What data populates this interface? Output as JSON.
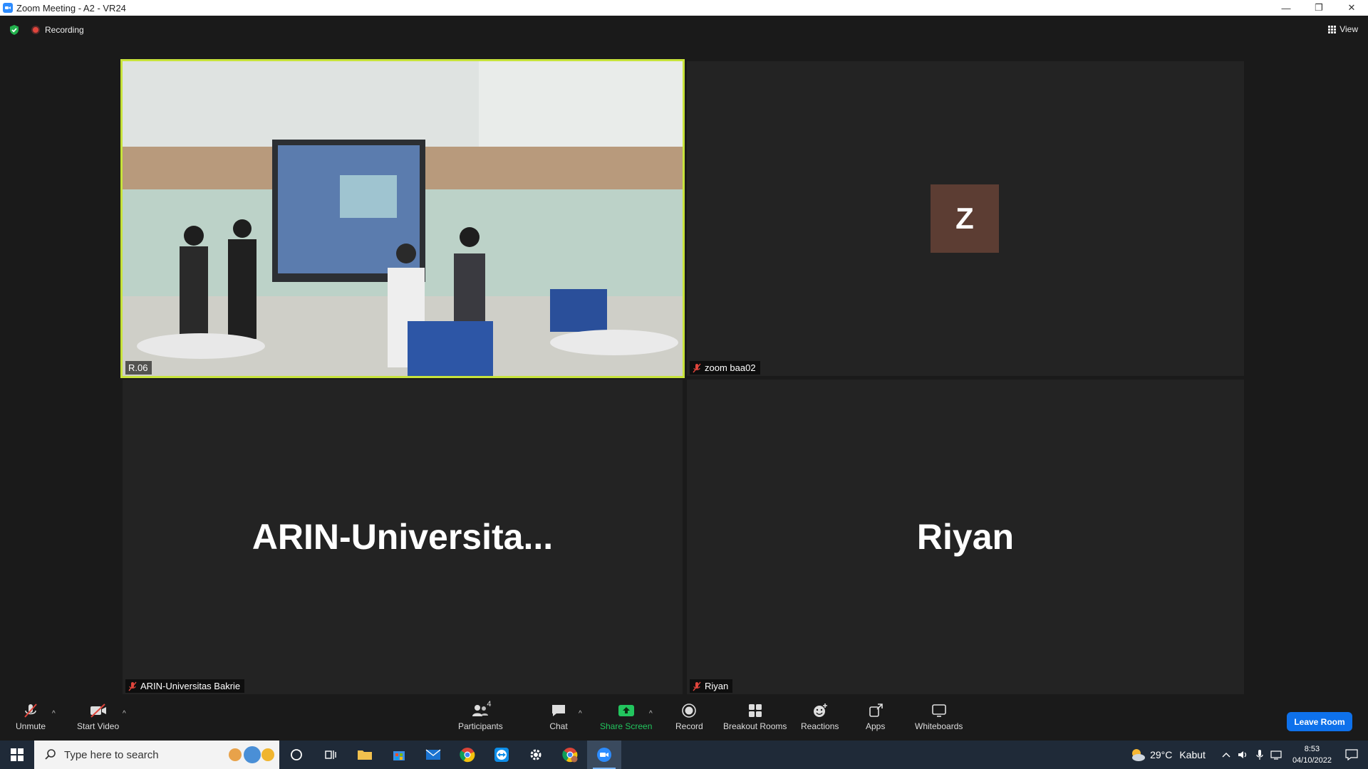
{
  "window": {
    "title": "Zoom Meeting - A2 - VR24",
    "minimize": "—",
    "restore": "❐",
    "close": "✕"
  },
  "topbar": {
    "recording_label": "Recording",
    "view_label": "View"
  },
  "tiles": [
    {
      "name": "R.06",
      "type": "video"
    },
    {
      "name": "zoom baa02",
      "avatar_letter": "Z",
      "avatar_color": "#5c3d33",
      "type": "avatar"
    },
    {
      "name": "ARIN-Universitas Bakrie",
      "display_name": "ARIN-Universita...",
      "type": "name"
    },
    {
      "name": "Riyan",
      "display_name": "Riyan",
      "type": "name"
    }
  ],
  "active_speaker_color": "#c7e33b",
  "toolbar": {
    "unmute": "Unmute",
    "start_video": "Start Video",
    "participants": "Participants",
    "participant_count": "4",
    "chat": "Chat",
    "share_screen": "Share Screen",
    "record": "Record",
    "breakout_rooms": "Breakout Rooms",
    "reactions": "Reactions",
    "apps": "Apps",
    "whiteboards": "Whiteboards",
    "leave_room": "Leave Room",
    "caret": "^"
  },
  "taskbar": {
    "search_placeholder": "Type here to search",
    "temperature": "29°C",
    "weather": "Kabut",
    "time": "8:53",
    "date": "04/10/2022",
    "apps": [
      "cortana-icon",
      "task-view-icon",
      "file-explorer-icon",
      "store-icon",
      "mail-icon",
      "chrome-icon",
      "teamviewer-icon",
      "settings-icon",
      "chrome-profile-icon",
      "zoom-icon"
    ]
  },
  "colors": {
    "leave_button": "#0e71eb",
    "share_green": "#22c55e",
    "recording_red": "#e0453c"
  }
}
